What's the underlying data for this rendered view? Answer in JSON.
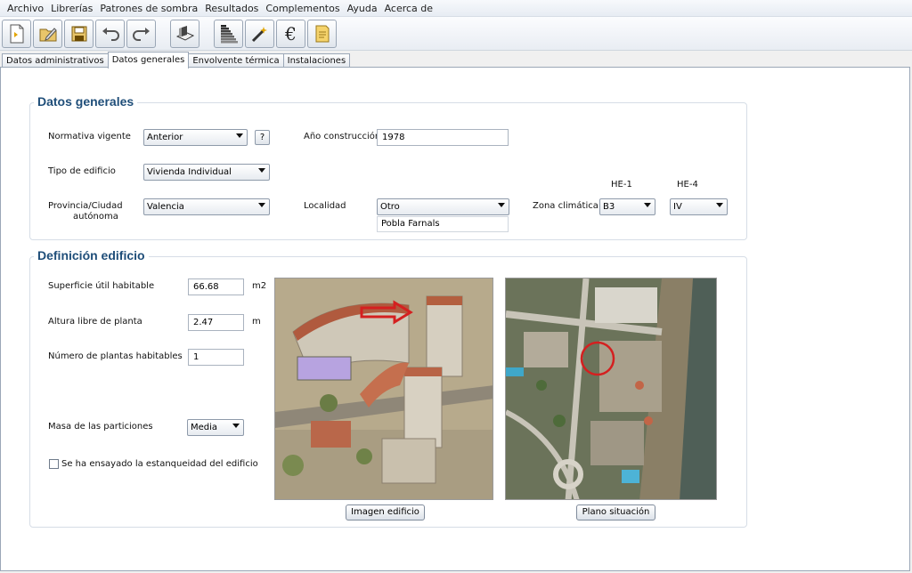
{
  "menu": [
    "Archivo",
    "Librerías",
    "Patrones de sombra",
    "Resultados",
    "Complementos",
    "Ayuda",
    "Acerca de"
  ],
  "toolbar_icons": [
    "new-file-icon",
    "open-folder-icon",
    "save-icon",
    "undo-icon",
    "redo-icon",
    "building-3d-icon",
    "energy-rating-icon",
    "magic-wand-icon",
    "euro-icon",
    "report-icon"
  ],
  "tabs": [
    "Datos administrativos",
    "Datos generales",
    "Envolvente térmica",
    "Instalaciones"
  ],
  "active_tab": "Datos generales",
  "datos_generales": {
    "title": "Datos generales",
    "normativa_label": "Normativa vigente",
    "normativa_value": "Anterior",
    "help_label": "?",
    "anio_label": "Año construcción",
    "anio_value": "1978",
    "tipo_label": "Tipo de edificio",
    "tipo_value": "Vivienda Individual",
    "provincia_label_1": "Provincia/Ciudad",
    "provincia_label_2": "autónoma",
    "provincia_value": "Valencia",
    "localidad_label": "Localidad",
    "localidad_value": "Otro",
    "localidad_text": "Pobla Farnals",
    "zona_label": "Zona climática",
    "he1_label": "HE-1",
    "he4_label": "HE-4",
    "he1_value": "B3",
    "he4_value": "IV"
  },
  "definicion": {
    "title": "Definición edificio",
    "superficie_label": "Superficie útil habitable",
    "superficie_value": "66.68",
    "superficie_unit": "m2",
    "altura_label": "Altura libre de planta",
    "altura_value": "2.47",
    "altura_unit": "m",
    "plantas_label": "Número de plantas habitables",
    "plantas_value": "1",
    "masa_label": "Masa de las particiones",
    "masa_value": "Media",
    "estanqueidad_label": "Se ha ensayado la estanqueidad del edificio",
    "imagen_button": "Imagen edificio",
    "plano_button": "Plano situación"
  },
  "colors": {
    "group_title": "#1f4e79",
    "accent_red": "#d42020"
  }
}
